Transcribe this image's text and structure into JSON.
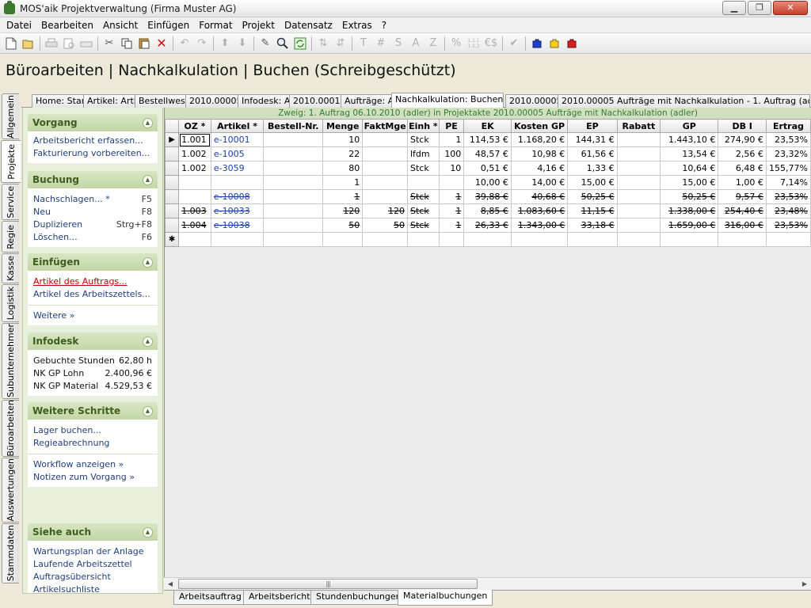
{
  "window": {
    "title": "MOS'aik Projektverwaltung (Firma Muster AG)"
  },
  "menu": [
    "Datei",
    "Bearbeiten",
    "Ansicht",
    "Einfügen",
    "Format",
    "Projekt",
    "Datensatz",
    "Extras",
    "?"
  ],
  "toolbar": {
    "icons": [
      "new-icon",
      "open-icon",
      "print-icon",
      "print-preview-icon",
      "print-setup-icon",
      "cut-icon",
      "copy-icon",
      "paste-icon",
      "delete-icon",
      "undo-icon",
      "redo-icon",
      "move-up-icon",
      "move-down-icon",
      "edit-icon",
      "find-icon",
      "refresh-icon",
      "sort-ascending-icon",
      "sort-descending-icon"
    ],
    "text_buttons": [
      "T",
      "#",
      "S",
      "A",
      "Z",
      "%",
      "1,1.1 1.1,2",
      "€$"
    ]
  },
  "page": {
    "heading": "Büroarbeiten | Nachkalkulation | Buchen (Schreibgeschützt)"
  },
  "vertical_tabs": [
    {
      "label": "Allgemein",
      "active": false
    },
    {
      "label": "Projekte",
      "active": true
    },
    {
      "label": "Service",
      "active": false
    },
    {
      "label": "Regie",
      "active": false
    },
    {
      "label": "Kasse",
      "active": false
    },
    {
      "label": "Logistik",
      "active": false
    },
    {
      "label": "Subunternehmer",
      "active": false
    },
    {
      "label": "Büroarbeiten",
      "active": false
    },
    {
      "label": "Auswertungen",
      "active": false
    },
    {
      "label": "Stammdaten",
      "active": false
    }
  ],
  "doc_tabs": [
    {
      "label": "Home: Start"
    },
    {
      "label": "Artikel: Artikel"
    },
    {
      "label": "Bestellwesen"
    },
    {
      "label": "2010.00005"
    },
    {
      "label": "Infodesk: Auftr"
    },
    {
      "label": "2010.00010"
    },
    {
      "label": "Aufträge: Auftr"
    },
    {
      "label": "Nachkalkulation: Buchen",
      "close": "✕",
      "active": true
    },
    {
      "label": "2010.00005"
    },
    {
      "label": "2010.00005 Aufträge mit Nachkalkulation - 1. Auftrag (adler)",
      "close": "✕"
    }
  ],
  "sidebar": {
    "vorgang": {
      "title": "Vorgang",
      "items": [
        "Arbeitsbericht erfassen...",
        "Fakturierung vorbereiten..."
      ]
    },
    "buchung": {
      "title": "Buchung",
      "items": [
        {
          "label": "Nachschlagen... *",
          "key": "F5"
        },
        {
          "label": "Neu",
          "key": "F8"
        },
        {
          "label": "Duplizieren",
          "key": "Strg+F8"
        },
        {
          "label": "Löschen...",
          "key": "F6"
        }
      ]
    },
    "einfuegen": {
      "title": "Einfügen",
      "items": [
        "Artikel des Auftrags...",
        "Artikel des Arbeitszettels..."
      ],
      "more": "Weitere »"
    },
    "infodesk": {
      "title": "Infodesk",
      "items": [
        {
          "label": "Gebuchte Stunden",
          "value": "62,80 h"
        },
        {
          "label": "NK GP Lohn",
          "value": "2.400,96 €"
        },
        {
          "label": "NK GP Material",
          "value": "4.529,53 €"
        }
      ]
    },
    "weitere": {
      "title": "Weitere Schritte",
      "items": [
        "Lager buchen...",
        "Regieabrechnung"
      ],
      "items2": [
        "Workflow anzeigen »",
        "Notizen zum Vorgang »"
      ]
    },
    "siehe": {
      "title": "Siehe auch",
      "items": [
        "Wartungsplan der Anlage",
        "Laufende Arbeitszettel",
        "Auftragsübersicht",
        "Artikelsuchliste"
      ]
    }
  },
  "grid": {
    "caption": "Zweig: 1. Auftrag 06.10.2010 (adler) in Projektakte 2010.00005 Aufträge mit Nachkalkulation (adler)",
    "columns": [
      "OZ *",
      "Artikel *",
      "Bestell-Nr.",
      "Menge",
      "FaktMge",
      "Einh *",
      "PE",
      "EK",
      "Kosten GP",
      "EP",
      "Rabatt",
      "GP",
      "DB I",
      "Ertrag"
    ],
    "rows": [
      {
        "indicator": "▶",
        "strike": false,
        "cells": [
          "1.001",
          "e-10001",
          "",
          "10",
          "",
          "Stck",
          "1",
          "114,53 €",
          "1.168,20 €",
          "144,31 €",
          "",
          "1.443,10 €",
          "274,90 €",
          "23,53%"
        ]
      },
      {
        "indicator": "",
        "strike": false,
        "cells": [
          "1.002",
          "e-1005",
          "",
          "22",
          "",
          "lfdm",
          "100",
          "48,57 €",
          "10,98 €",
          "61,56 €",
          "",
          "13,54 €",
          "2,56 €",
          "23,32%"
        ]
      },
      {
        "indicator": "",
        "strike": false,
        "cells": [
          "1.002",
          "e-3059",
          "",
          "80",
          "",
          "Stck",
          "10",
          "0,51 €",
          "4,16 €",
          "1,33 €",
          "",
          "10,64 €",
          "6,48 €",
          "155,77%"
        ]
      },
      {
        "indicator": "",
        "strike": false,
        "cells": [
          "",
          "",
          "",
          "1",
          "",
          "",
          "",
          "10,00 €",
          "14,00 €",
          "15,00 €",
          "",
          "15,00 €",
          "1,00 €",
          "7,14%"
        ]
      },
      {
        "indicator": "",
        "strike": true,
        "cells": [
          "",
          "e-10008",
          "",
          "1",
          "",
          "Stck",
          "1",
          "39,88 €",
          "40,68 €",
          "50,25 €",
          "",
          "50,25 €",
          "9,57 €",
          "23,53%"
        ]
      },
      {
        "indicator": "",
        "strike": true,
        "cells": [
          "1.003",
          "e-10033",
          "",
          "120",
          "120",
          "Stck",
          "1",
          "8,85 €",
          "1.083,60 €",
          "11,15 €",
          "",
          "1.338,00 €",
          "254,40 €",
          "23,48%"
        ]
      },
      {
        "indicator": "",
        "strike": true,
        "cells": [
          "1.004",
          "e-10038",
          "",
          "50",
          "50",
          "Stck",
          "1",
          "26,33 €",
          "1.343,00 €",
          "33,18 €",
          "",
          "1.659,00 €",
          "316,00 €",
          "23,53%"
        ]
      },
      {
        "indicator": "✱",
        "strike": false,
        "cells": [
          "",
          "",
          "",
          "",
          "",
          "",
          "",
          "",
          "",
          "",
          "",
          "",
          "",
          ""
        ]
      }
    ]
  },
  "bottom_tabs": [
    {
      "label": "Arbeitsauftrag",
      "active": false
    },
    {
      "label": "Arbeitsbericht",
      "active": false
    },
    {
      "label": "Stundenbuchungen",
      "active": false
    },
    {
      "label": "Materialbuchungen",
      "active": true
    }
  ]
}
